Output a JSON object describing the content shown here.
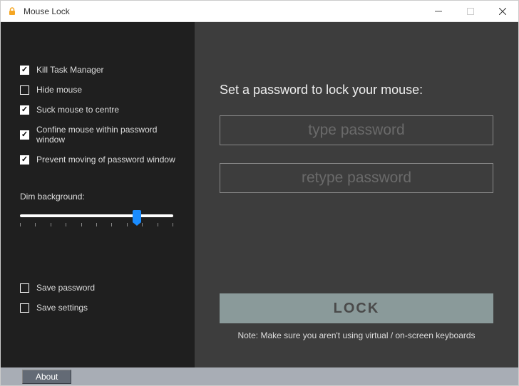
{
  "window": {
    "title": "Mouse Lock"
  },
  "options": {
    "kill_task_manager": {
      "label": "Kill Task Manager",
      "checked": true
    },
    "hide_mouse": {
      "label": "Hide mouse",
      "checked": false
    },
    "suck_mouse": {
      "label": "Suck mouse to centre",
      "checked": true
    },
    "confine_mouse": {
      "label": "Confine mouse within password window",
      "checked": true
    },
    "prevent_move": {
      "label": "Prevent moving of password window",
      "checked": true
    }
  },
  "dim": {
    "label": "Dim background:",
    "value_percent": 76
  },
  "save": {
    "save_password": {
      "label": "Save password",
      "checked": false
    },
    "save_settings": {
      "label": "Save settings",
      "checked": false
    }
  },
  "main": {
    "heading": "Set a password to lock your mouse:",
    "password_placeholder": "type password",
    "retype_placeholder": "retype password",
    "lock_label": "LOCK",
    "note": "Note: Make sure you aren't using virtual / on-screen keyboards"
  },
  "status": {
    "about_label": "About"
  }
}
